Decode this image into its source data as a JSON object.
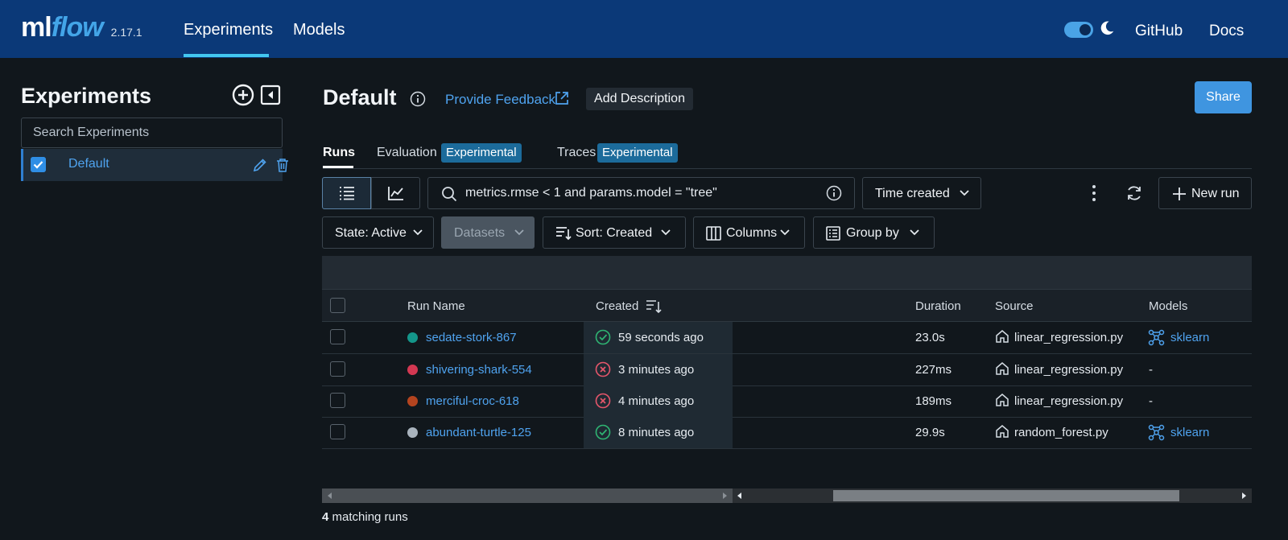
{
  "app": {
    "logo_ml": "ml",
    "logo_flow": "flow",
    "version": "2.17.1",
    "nav": [
      {
        "label": "Experiments"
      },
      {
        "label": "Models"
      }
    ],
    "links": {
      "github": "GitHub",
      "docs": "Docs"
    }
  },
  "sidebar": {
    "title": "Experiments",
    "search_placeholder": "Search Experiments",
    "items": [
      {
        "label": "Default",
        "selected": true
      }
    ]
  },
  "header": {
    "title": "Default",
    "feedback": "Provide Feedback",
    "add_description": "Add Description",
    "share": "Share"
  },
  "tabs": [
    {
      "label": "Runs",
      "active": true
    },
    {
      "label": "Evaluation",
      "badge": "Experimental"
    },
    {
      "label": "Traces",
      "badge": "Experimental"
    }
  ],
  "toolbar": {
    "search_value": "metrics.rmse < 1 and params.model = \"tree\"",
    "time_created": "Time created",
    "new_run": "New run",
    "state": "State: Active",
    "datasets": "Datasets",
    "sort": "Sort: Created",
    "columns": "Columns",
    "group_by": "Group by"
  },
  "table": {
    "headers": {
      "run_name": "Run Name",
      "created": "Created",
      "duration": "Duration",
      "source": "Source",
      "models": "Models"
    },
    "rows": [
      {
        "name": "sedate-stork-867",
        "color": "#14968a",
        "status": "success",
        "created": "59 seconds ago",
        "duration": "23.0s",
        "source": "linear_regression.py",
        "model": "sklearn"
      },
      {
        "name": "shivering-shark-554",
        "color": "#d43852",
        "status": "failed",
        "created": "3 minutes ago",
        "duration": "227ms",
        "source": "linear_regression.py",
        "model": "-"
      },
      {
        "name": "merciful-croc-618",
        "color": "#b4441f",
        "status": "failed",
        "created": "4 minutes ago",
        "duration": "189ms",
        "source": "linear_regression.py",
        "model": "-"
      },
      {
        "name": "abundant-turtle-125",
        "color": "#a9b3bd",
        "status": "success",
        "created": "8 minutes ago",
        "duration": "29.9s",
        "source": "random_forest.py",
        "model": "sklearn"
      }
    ]
  },
  "footer": {
    "count": "4",
    "count_suffix": " matching runs"
  },
  "colors": {
    "accent": "#43a5e8",
    "topbar": "#0b3978",
    "link": "#4fa3ef",
    "success": "#2fb573",
    "failed": "#e5566b"
  }
}
